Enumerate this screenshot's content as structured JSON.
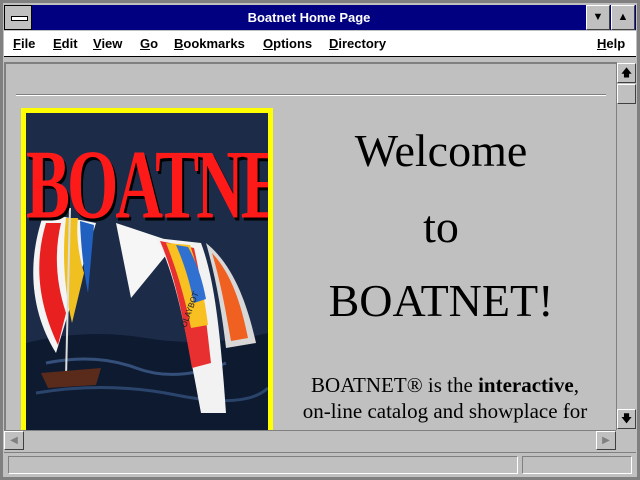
{
  "window": {
    "title": "Boatnet Home Page"
  },
  "menu": [
    {
      "label": "File"
    },
    {
      "label": "Edit"
    },
    {
      "label": "View"
    },
    {
      "label": "Go"
    },
    {
      "label": "Bookmarks"
    },
    {
      "label": "Options"
    },
    {
      "label": "Directory"
    },
    {
      "label": "Help"
    }
  ],
  "page": {
    "logo_text": "BOATNET",
    "welcome_lines": [
      "Welcome",
      "to",
      "BOATNET!"
    ],
    "intro_start": "BOATNET® is the ",
    "intro_bold": "interactive",
    "intro_end": ",",
    "intro_line2": "on-line catalog and showplace for"
  },
  "colors": {
    "titlebar": "#000080",
    "logo_border": "#ffff00",
    "logo_text": "#ff1a1a"
  },
  "icons": {
    "system_menu": "system-menu-icon",
    "minimize": "minimize-icon",
    "maximize": "maximize-icon",
    "scroll_up": "arrow-up-icon",
    "scroll_down": "arrow-down-icon",
    "scroll_left": "arrow-left-icon",
    "scroll_right": "arrow-right-icon"
  }
}
